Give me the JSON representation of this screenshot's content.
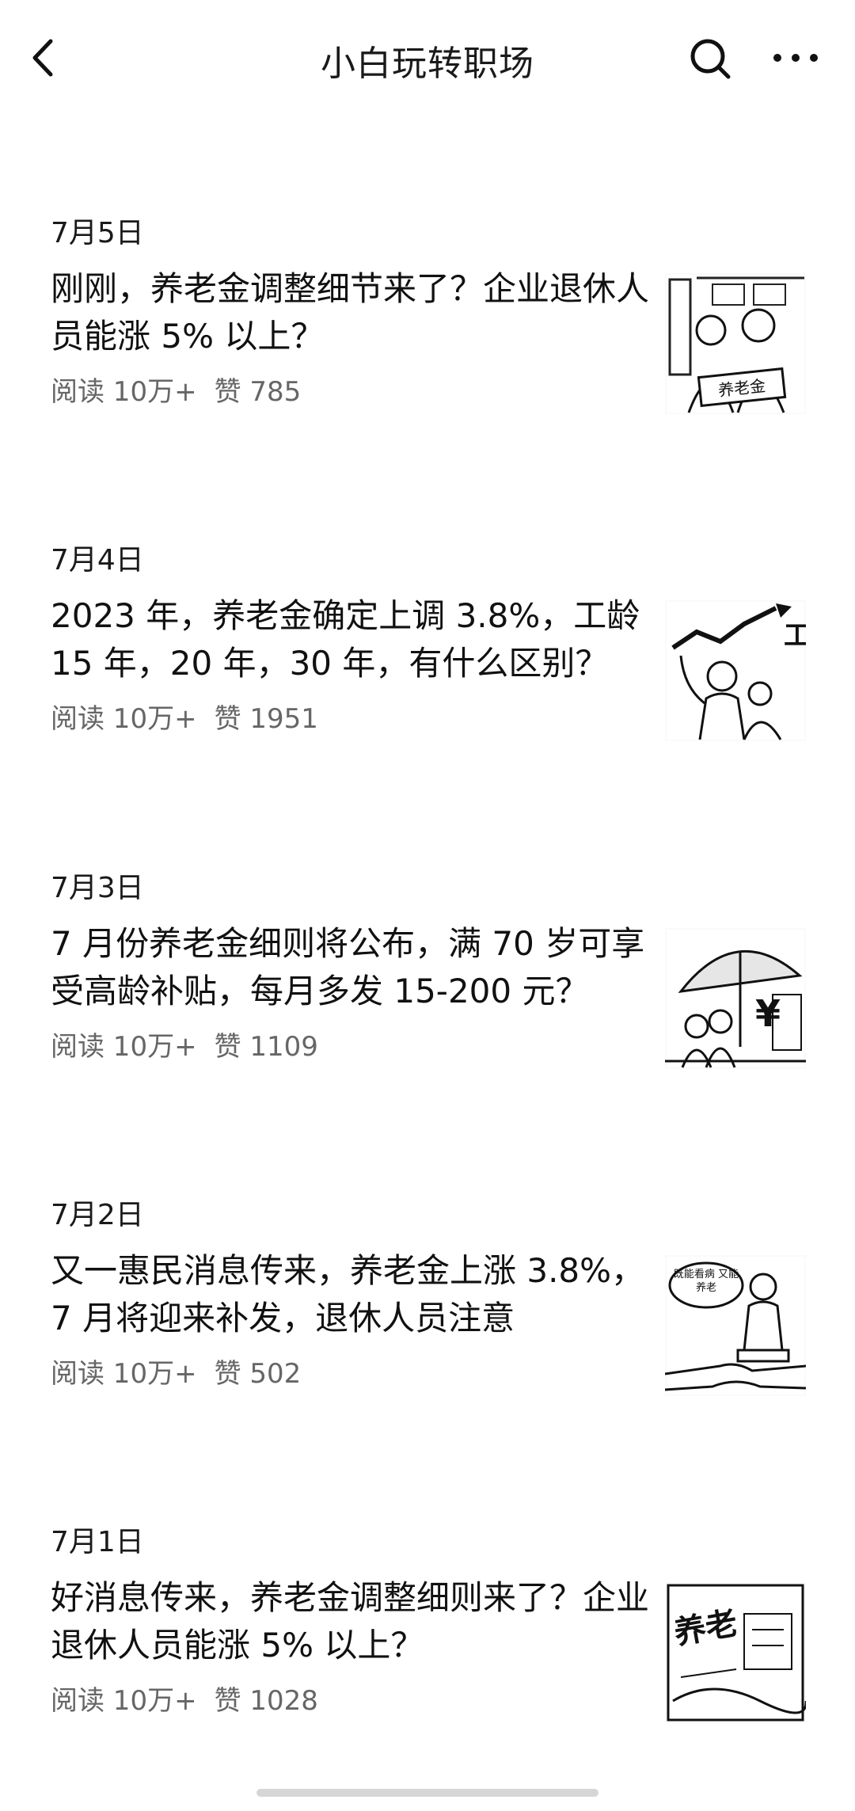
{
  "header": {
    "title": "小白玩转职场",
    "back_icon": "chevron-left-icon",
    "search_icon": "search-icon",
    "more_icon": "more-horizontal-icon"
  },
  "groups": [
    {
      "date": "7月5日",
      "article": {
        "title": "刚刚，养老金调整细节来了？企业退休人员能涨 5% 以上？",
        "reads": "阅读 10万+",
        "likes": "赞 785",
        "thumb_label": "养老金"
      }
    },
    {
      "date": "7月4日",
      "article": {
        "title": "2023 年，养老金确定上调 3.8%，工龄 15 年，20 年，30 年，有什么区别？",
        "reads": "阅读 10万+",
        "likes": "赞 1951",
        "thumb_label": "工龄"
      }
    },
    {
      "date": "7月3日",
      "article": {
        "title": "7 月份养老金细则将公布，满 70 岁可享受高龄补贴，每月多发 15-200 元？",
        "reads": "阅读 10万+",
        "likes": "赞 1109",
        "thumb_label": "¥"
      }
    },
    {
      "date": "7月2日",
      "article": {
        "title": "又一惠民消息传来，养老金上涨 3.8%，7 月将迎来补发，退休人员注意",
        "reads": "阅读 10万+",
        "likes": "赞 502",
        "thumb_label": "既能看病 又能养老"
      }
    },
    {
      "date": "7月1日",
      "article": {
        "title": "好消息传来，养老金调整细则来了？企业退休人员能涨 5% 以上？",
        "reads": "阅读 10万+",
        "likes": "赞 1028",
        "thumb_label": "养老"
      }
    }
  ]
}
